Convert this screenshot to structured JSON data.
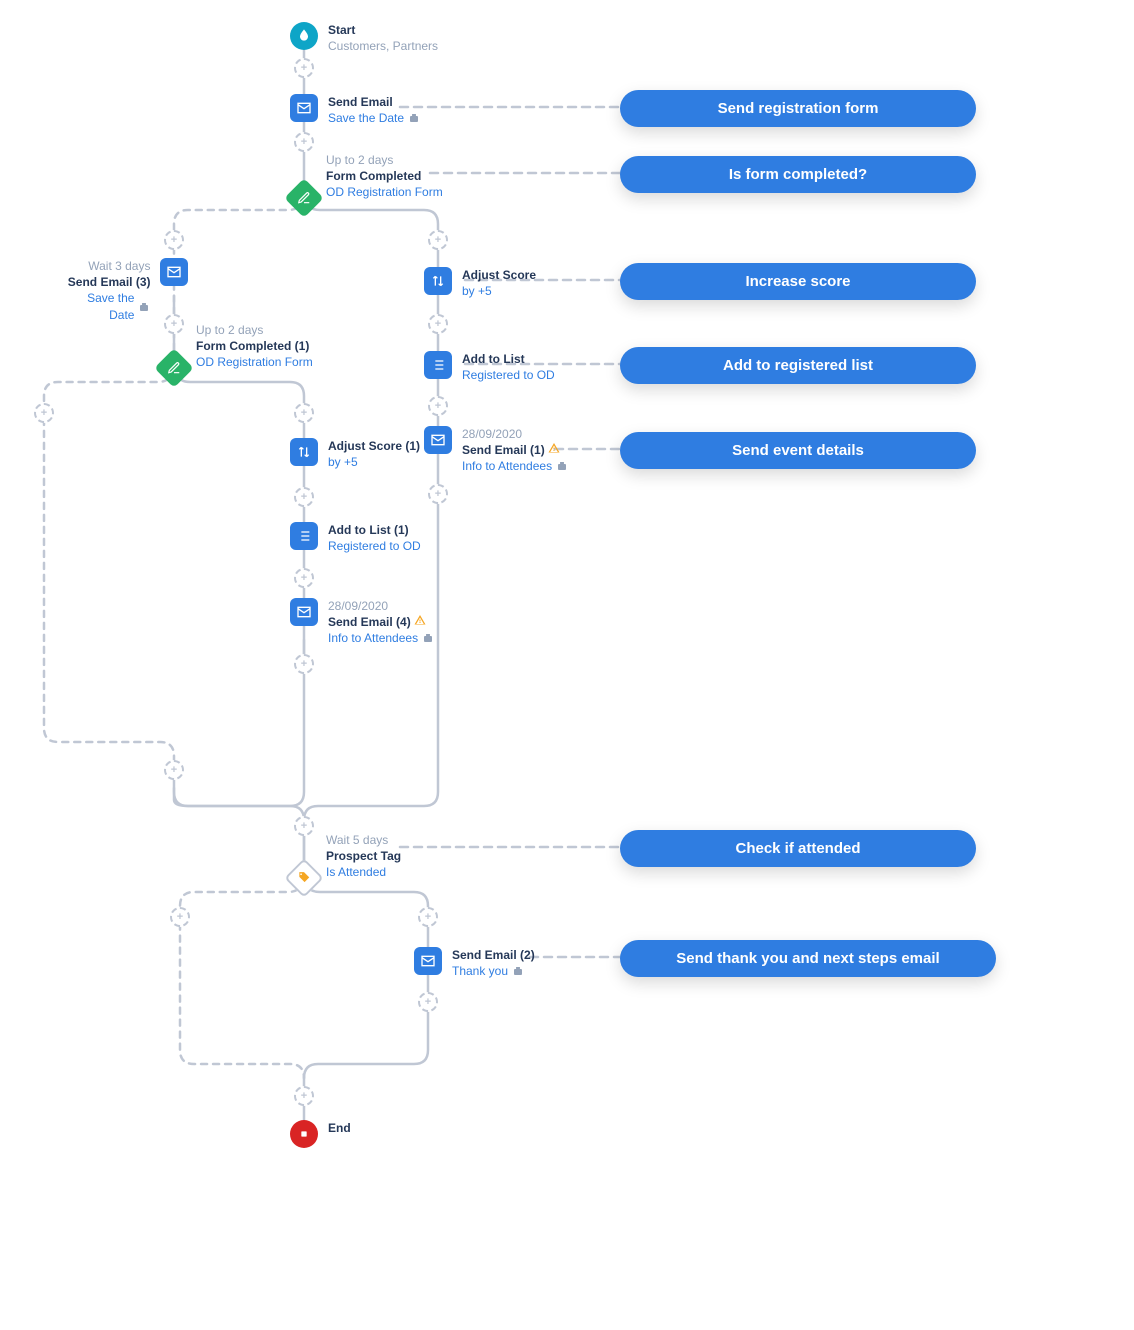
{
  "colors": {
    "solid": "#c0c7d4",
    "accent": "#2f7de1"
  },
  "nodes": {
    "start": {
      "title": "Start",
      "sub": "Customers, Partners"
    },
    "sendEmail1": {
      "title": "Send Email",
      "sub": "Save the Date"
    },
    "formCompleted": {
      "pre": "Up to 2 days",
      "title": "Form Completed",
      "sub": "OD Registration Form"
    },
    "adjustScore": {
      "title": "Adjust Score",
      "sub": "by +5"
    },
    "addToList": {
      "title": "Add to List",
      "sub": "Registered to OD"
    },
    "sendEmailR1": {
      "pre": "28/09/2020",
      "title": "Send Email (1)",
      "sub": "Info to Attendees"
    },
    "sendEmail3": {
      "pre": "Wait 3 days",
      "title": "Send Email (3)",
      "sub": "Save the Date"
    },
    "formCompleted1": {
      "pre": "Up to 2 days",
      "title": "Form Completed (1)",
      "sub": "OD Registration Form"
    },
    "adjustScore1": {
      "title": "Adjust Score (1)",
      "sub": "by +5"
    },
    "addToList1": {
      "title": "Add to List (1)",
      "sub": "Registered to OD"
    },
    "sendEmail4": {
      "pre": "28/09/2020",
      "title": "Send Email (4)",
      "sub": "Info to Attendees"
    },
    "prospectTag": {
      "pre": "Wait 5 days",
      "title": "Prospect Tag",
      "sub": "Is Attended"
    },
    "sendEmail2": {
      "title": "Send Email (2)",
      "sub": "Thank you"
    },
    "end": {
      "title": "End"
    }
  },
  "callouts": {
    "c1": "Send registration form",
    "c2": "Is form completed?",
    "c3": "Increase score",
    "c4": "Add to registered list",
    "c5": "Send event details",
    "c6": "Check if attended",
    "c7": "Send thank you and next steps email"
  }
}
